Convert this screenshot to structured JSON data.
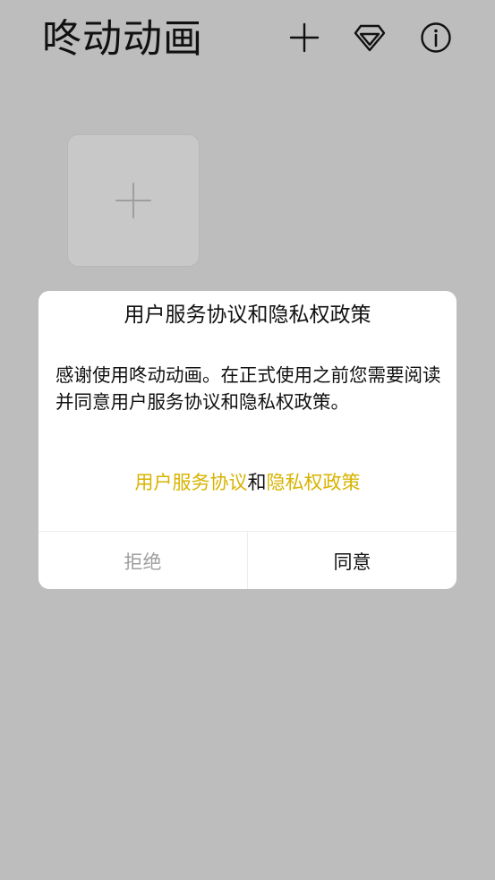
{
  "app": {
    "title": "咚动动画"
  },
  "header": {
    "icons": [
      "plus-icon",
      "diamond-icon",
      "info-icon"
    ]
  },
  "tile": {
    "icon": "plus-icon"
  },
  "dialog": {
    "title": "用户服务协议和隐私权政策",
    "message": "感谢使用咚动动画。在正式使用之前您需要阅读并同意用户服务协议和隐私权政策。",
    "links": {
      "service_agreement": "用户服务协议",
      "and": "和",
      "privacy_policy": "隐私权政策"
    },
    "buttons": {
      "reject": "拒绝",
      "accept": "同意"
    }
  },
  "colors": {
    "background_overlay": "#bdbdbd",
    "link": "#d8b300",
    "reject_text": "#9e9e9e",
    "dialog_bg": "#ffffff"
  }
}
